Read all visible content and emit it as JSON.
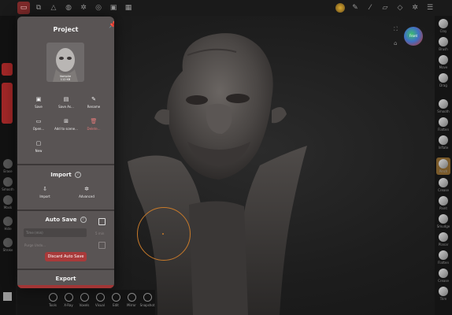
{
  "topbar": {
    "buttons": [
      {
        "icon": "file-icon",
        "active": true
      },
      {
        "icon": "scene-icon",
        "active": false
      },
      {
        "icon": "topology-icon",
        "active": false
      },
      {
        "icon": "sphere-icon",
        "active": false
      },
      {
        "icon": "gear-icon",
        "active": false
      },
      {
        "icon": "material-icon",
        "active": false
      },
      {
        "icon": "image-icon",
        "active": false
      },
      {
        "icon": "grid-icon",
        "active": false
      }
    ],
    "right_icons": [
      "avatar-icon",
      "pen-icon",
      "eyedropper-icon",
      "ruler-icon",
      "cube-icon",
      "gear-icon",
      "menu-icon"
    ]
  },
  "panel": {
    "title": "Project",
    "thumbnail_caption": [
      "Vampire",
      "112 KB"
    ],
    "actions": [
      {
        "label": "Save",
        "icon": "save-icon"
      },
      {
        "label": "Save As...",
        "icon": "save-as-icon"
      },
      {
        "label": "Rename",
        "icon": "rename-icon"
      },
      {
        "label": "Open...",
        "icon": "folder-icon"
      },
      {
        "label": "Add to scene...",
        "icon": "add-to-scene-icon"
      },
      {
        "label": "Delete...",
        "icon": "trash-icon",
        "danger": true
      },
      {
        "label": "New",
        "icon": "new-file-icon"
      }
    ],
    "import": {
      "title": "Import",
      "help": "?",
      "actions": [
        {
          "label": "Import",
          "icon": "import-icon"
        },
        {
          "label": "Advanced",
          "icon": "gear-icon"
        }
      ]
    },
    "autosave": {
      "title": "Auto Save",
      "help": "?",
      "time_placeholder": "Time (min)",
      "time_value": "5 min",
      "purge_label": "Purge Undo...",
      "discard_label": "Discard Auto Save"
    },
    "export": {
      "title": "Export"
    }
  },
  "leftbar": {
    "items": [
      "Erase",
      "Smooth",
      "Mask",
      "Hide",
      "Stroke"
    ]
  },
  "rightbar": {
    "items": [
      "Clay",
      "Brush",
      "Move",
      "Drag",
      "Smooth",
      "Flatten",
      "Inflate",
      "Pinch",
      "Crease",
      "Paint",
      "Smudge",
      "Planar",
      "Flatten",
      "Crease",
      "Trim",
      "Mask"
    ]
  },
  "bottombar": {
    "items": [
      "Tools",
      "X-Ray",
      "Voxels",
      "Visual",
      "Edit",
      "Mirror",
      "Snapshot"
    ]
  },
  "gizmo": {
    "label": "Front"
  },
  "colors": {
    "accent": "#a83a3a",
    "panel_bg": "#595454",
    "brush_ring": "#c87a2a"
  }
}
